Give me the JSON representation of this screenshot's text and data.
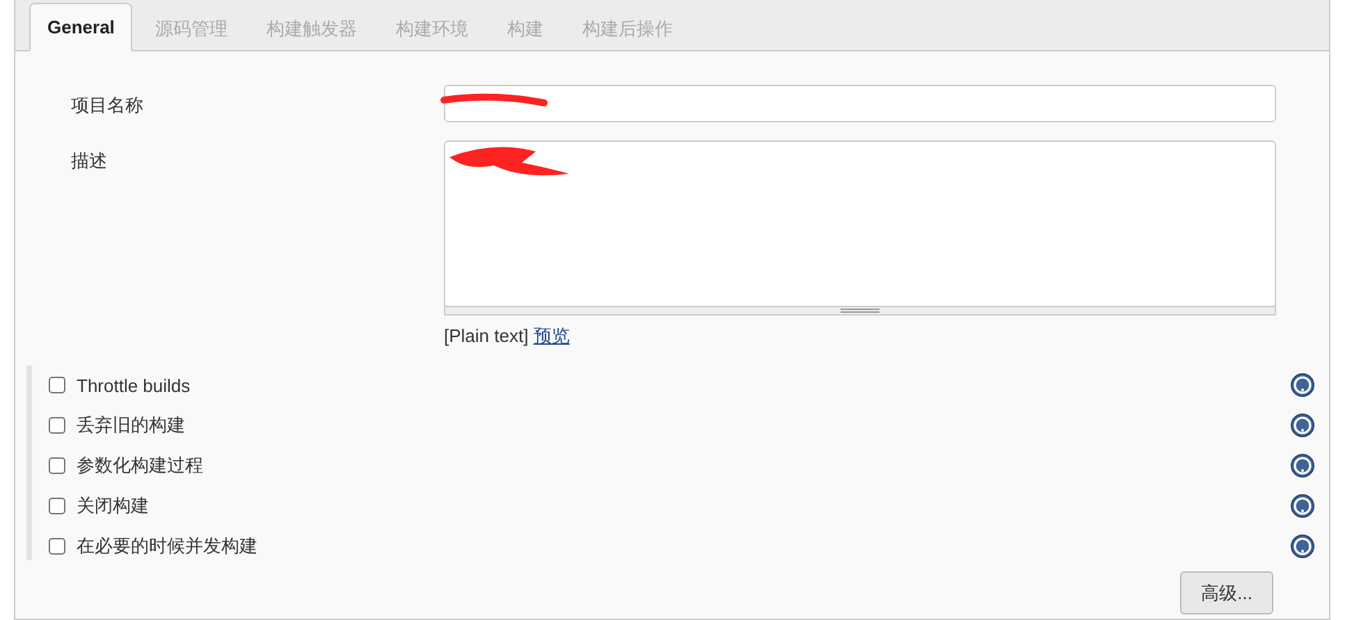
{
  "tabs": [
    {
      "label": "General",
      "selected": true
    },
    {
      "label": "源码管理",
      "selected": false
    },
    {
      "label": "构建触发器",
      "selected": false
    },
    {
      "label": "构建环境",
      "selected": false
    },
    {
      "label": "构建",
      "selected": false
    },
    {
      "label": "构建后操作",
      "selected": false
    }
  ],
  "project_name": {
    "label": "项目名称"
  },
  "description": {
    "label": "描述",
    "format_note": "[Plain text]",
    "preview_link": "预览"
  },
  "options": [
    {
      "label": "Throttle builds",
      "checked": false
    },
    {
      "label": "丢弃旧的构建",
      "checked": false
    },
    {
      "label": "参数化构建过程",
      "checked": false
    },
    {
      "label": "关闭构建",
      "checked": false
    },
    {
      "label": "在必要的时候并发构建",
      "checked": false
    }
  ],
  "advanced_button": "高级..."
}
